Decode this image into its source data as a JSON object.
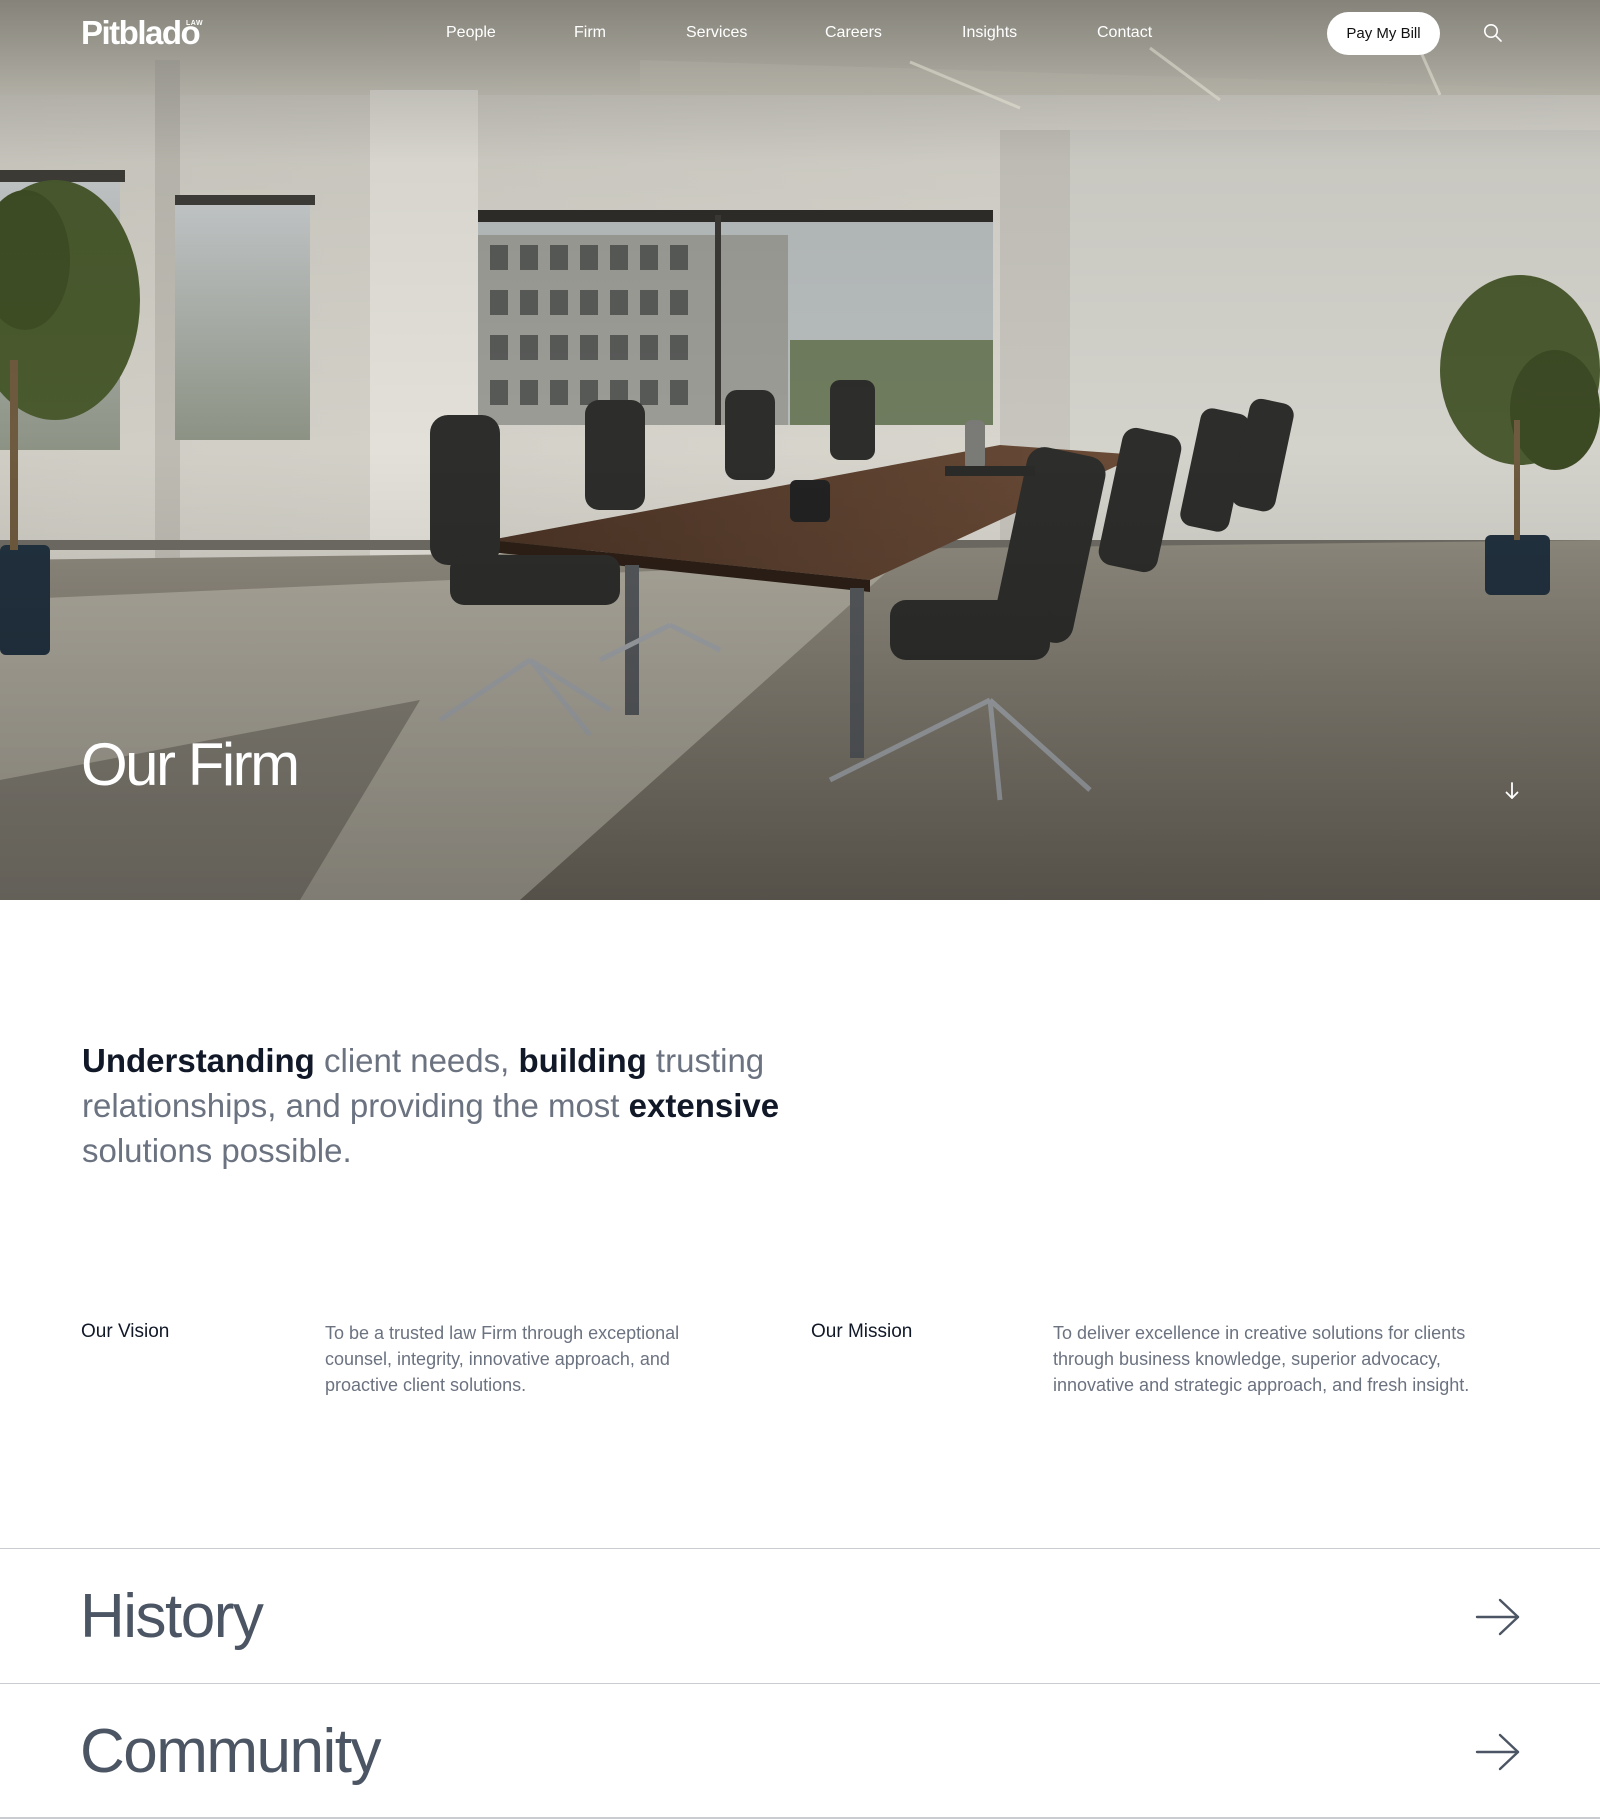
{
  "brand": {
    "logo_text": "Pitblado",
    "logo_sup": "LAW"
  },
  "nav": {
    "items": [
      {
        "label": "People"
      },
      {
        "label": "Firm"
      },
      {
        "label": "Services"
      },
      {
        "label": "Careers"
      },
      {
        "label": "Insights"
      },
      {
        "label": "Contact"
      }
    ],
    "pay_label": "Pay My Bill",
    "search_icon": "search-icon"
  },
  "hero": {
    "title": "Our Firm",
    "scroll_icon": "arrow-down-icon"
  },
  "intro": {
    "parts": [
      {
        "text": "Understanding",
        "bold": true
      },
      {
        "text": " client needs, ",
        "bold": false
      },
      {
        "text": "building",
        "bold": true
      },
      {
        "text": " trusting relationships, and providing the most ",
        "bold": false
      },
      {
        "text": "extensive",
        "bold": true
      },
      {
        "text": " solutions possible.",
        "bold": false
      }
    ]
  },
  "vision": {
    "label": "Our Vision",
    "text": "To be a trusted law Firm through exceptional counsel, integrity, innovative approach, and proactive client solutions."
  },
  "mission": {
    "label": "Our Mission",
    "text": "To deliver excellence in creative solutions for clients through business knowledge, superior advocacy, innovative and strategic approach, and fresh insight."
  },
  "sections": [
    {
      "title": "History",
      "icon": "arrow-right-icon"
    },
    {
      "title": "Community",
      "icon": "arrow-right-icon"
    }
  ],
  "colors": {
    "text_dark": "#111827",
    "text_muted": "#6b7280",
    "divider": "#c9ccd1",
    "button_bg": "#ffffff"
  }
}
